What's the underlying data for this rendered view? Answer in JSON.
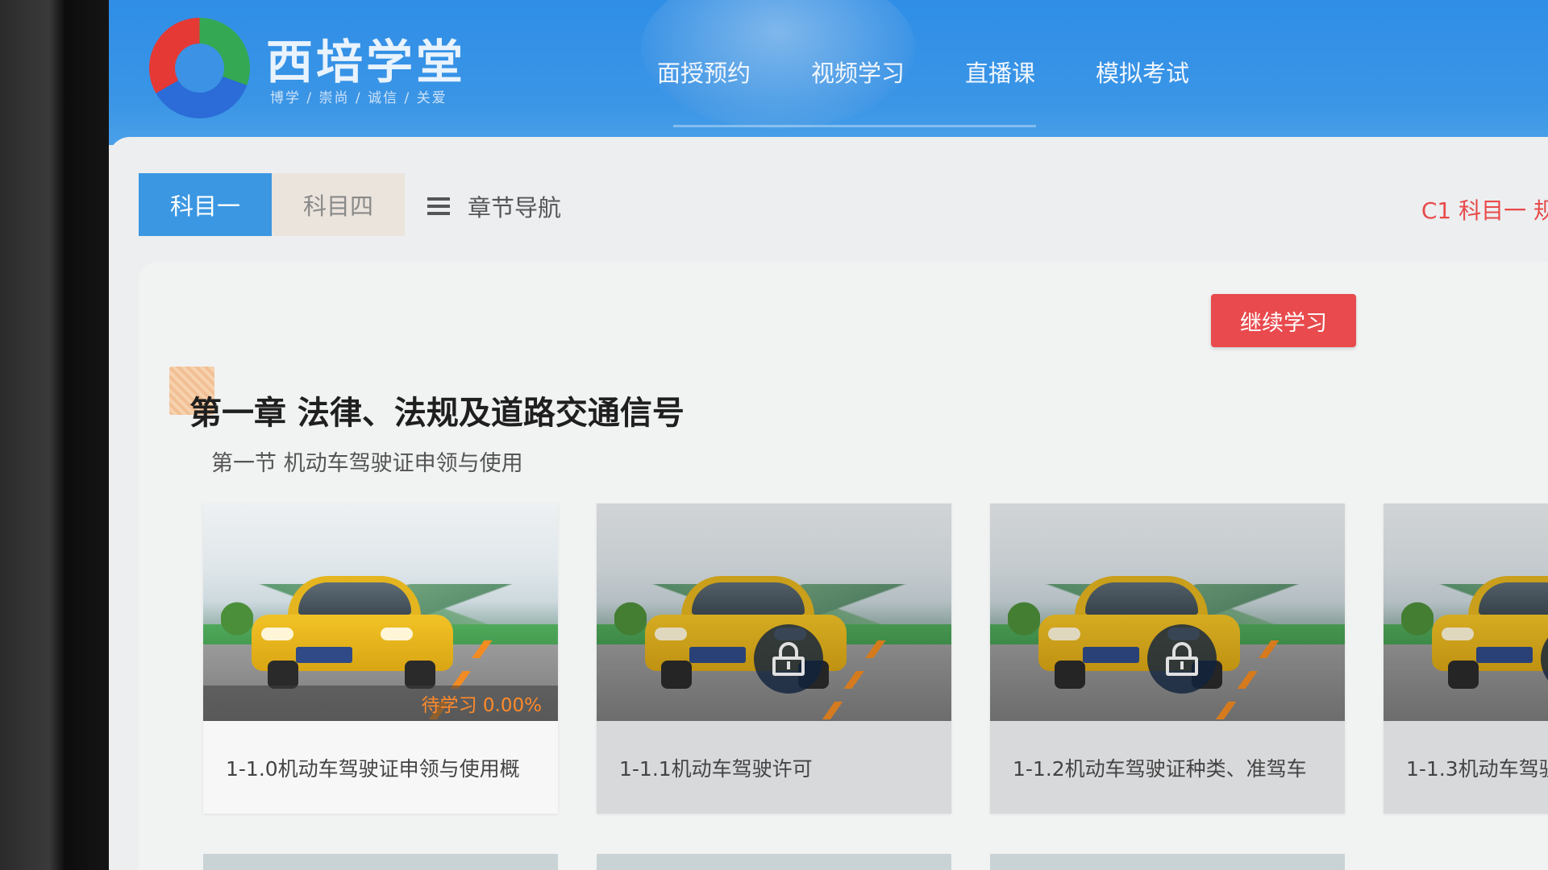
{
  "header": {
    "brand_name": "西培学堂",
    "slogan": "博学 / 崇尚 / 诚信 / 关爱",
    "nav": [
      {
        "label": "面授预约"
      },
      {
        "label": "视频学习"
      },
      {
        "label": "直播课"
      },
      {
        "label": "模拟考试"
      }
    ]
  },
  "subject_tabs": {
    "items": [
      {
        "label": "科目一",
        "active": true
      },
      {
        "label": "科目四",
        "active": false
      }
    ],
    "chapter_nav_label": "章节导航"
  },
  "course_tag": "C1 科目一  规",
  "continue_button": "继续学习",
  "chapter": {
    "title": "第一章 法律、法规及道路交通信号",
    "section": "第一节 机动车驾驶证申领与使用"
  },
  "lessons": [
    {
      "title": "1-1.0机动车驾驶证申领与使用概",
      "locked": false,
      "status": "待学习 0.00%"
    },
    {
      "title": "1-1.1机动车驾驶许可",
      "locked": true,
      "status": ""
    },
    {
      "title": "1-1.2机动车驾驶证种类、准驾车",
      "locked": true,
      "status": ""
    },
    {
      "title": "1-1.3机动车驾驶",
      "locked": true,
      "status": ""
    }
  ],
  "colors": {
    "header_blue": "#3a95e6",
    "active_tab": "#3b97e2",
    "continue_button": "#e84a4d",
    "progress_text": "#ff8a2a",
    "course_tag": "#e84a4a"
  }
}
